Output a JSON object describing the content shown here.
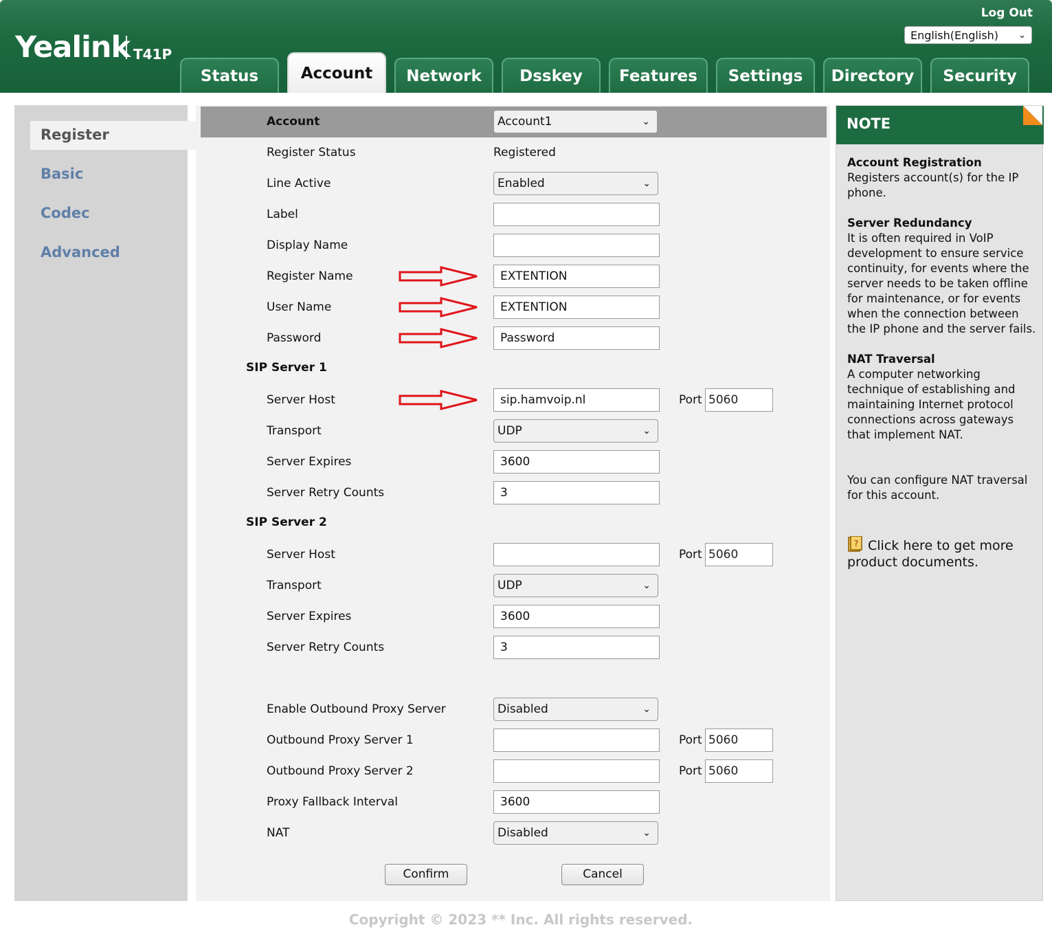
{
  "header": {
    "logo": "Yealink",
    "model": "T41P",
    "logout": "Log Out",
    "language": "English(English)"
  },
  "tabs": [
    {
      "label": "Status"
    },
    {
      "label": "Account"
    },
    {
      "label": "Network"
    },
    {
      "label": "Dsskey"
    },
    {
      "label": "Features"
    },
    {
      "label": "Settings"
    },
    {
      "label": "Directory"
    },
    {
      "label": "Security"
    }
  ],
  "sidebar": {
    "items": [
      {
        "label": "Register"
      },
      {
        "label": "Basic"
      },
      {
        "label": "Codec"
      },
      {
        "label": "Advanced"
      }
    ]
  },
  "form": {
    "account_label": "Account",
    "account_value": "Account1",
    "register_status_label": "Register Status",
    "register_status_value": "Registered",
    "line_active_label": "Line Active",
    "line_active_value": "Enabled",
    "label_label": "Label",
    "label_value": "",
    "display_name_label": "Display Name",
    "display_name_value": "",
    "register_name_label": "Register Name",
    "register_name_value": "EXTENTION",
    "user_name_label": "User Name",
    "user_name_value": "EXTENTION",
    "password_label": "Password",
    "password_value": "Password",
    "sip1": {
      "title": "SIP Server 1",
      "host_label": "Server Host",
      "host_value": "sip.hamvoip.nl",
      "port_label": "Port",
      "port_value": "5060",
      "transport_label": "Transport",
      "transport_value": "UDP",
      "expires_label": "Server Expires",
      "expires_value": "3600",
      "retry_label": "Server Retry Counts",
      "retry_value": "3"
    },
    "sip2": {
      "title": "SIP Server 2",
      "host_label": "Server Host",
      "host_value": "",
      "port_label": "Port",
      "port_value": "5060",
      "transport_label": "Transport",
      "transport_value": "UDP",
      "expires_label": "Server Expires",
      "expires_value": "3600",
      "retry_label": "Server Retry Counts",
      "retry_value": "3"
    },
    "outbound_enable_label": "Enable Outbound Proxy Server",
    "outbound_enable_value": "Disabled",
    "outbound1_label": "Outbound Proxy Server 1",
    "outbound1_value": "",
    "outbound1_port_label": "Port",
    "outbound1_port": "5060",
    "outbound2_label": "Outbound Proxy Server 2",
    "outbound2_value": "",
    "outbound2_port_label": "Port",
    "outbound2_port": "5060",
    "fallback_label": "Proxy Fallback Interval",
    "fallback_value": "3600",
    "nat_label": "NAT",
    "nat_value": "Disabled",
    "confirm": "Confirm",
    "cancel": "Cancel"
  },
  "note": {
    "title": "NOTE",
    "account_reg_title": "Account Registration",
    "account_reg_text": "Registers account(s) for the IP phone.",
    "redundancy_title": "Server Redundancy",
    "redundancy_text": "It is often required in VoIP development to ensure service continuity, for events where the server needs to be taken offline for maintenance, or for events when the connection between the IP phone and the server fails.",
    "nat_title": "NAT Traversal",
    "nat_text": "A computer networking technique of establishing and maintaining Internet protocol connections across gateways that implement NAT.",
    "nat_config": "You can configure NAT traversal for this account.",
    "docs_link": "Click here to get more product documents."
  },
  "footer": "Copyright © 2023 ** Inc. All rights reserved.",
  "colors": {
    "header_green": "#1d6a40",
    "arrow_red": "#e0141b",
    "note_corner": "#f18b1b",
    "sidebar_link": "#5f7fa8"
  }
}
